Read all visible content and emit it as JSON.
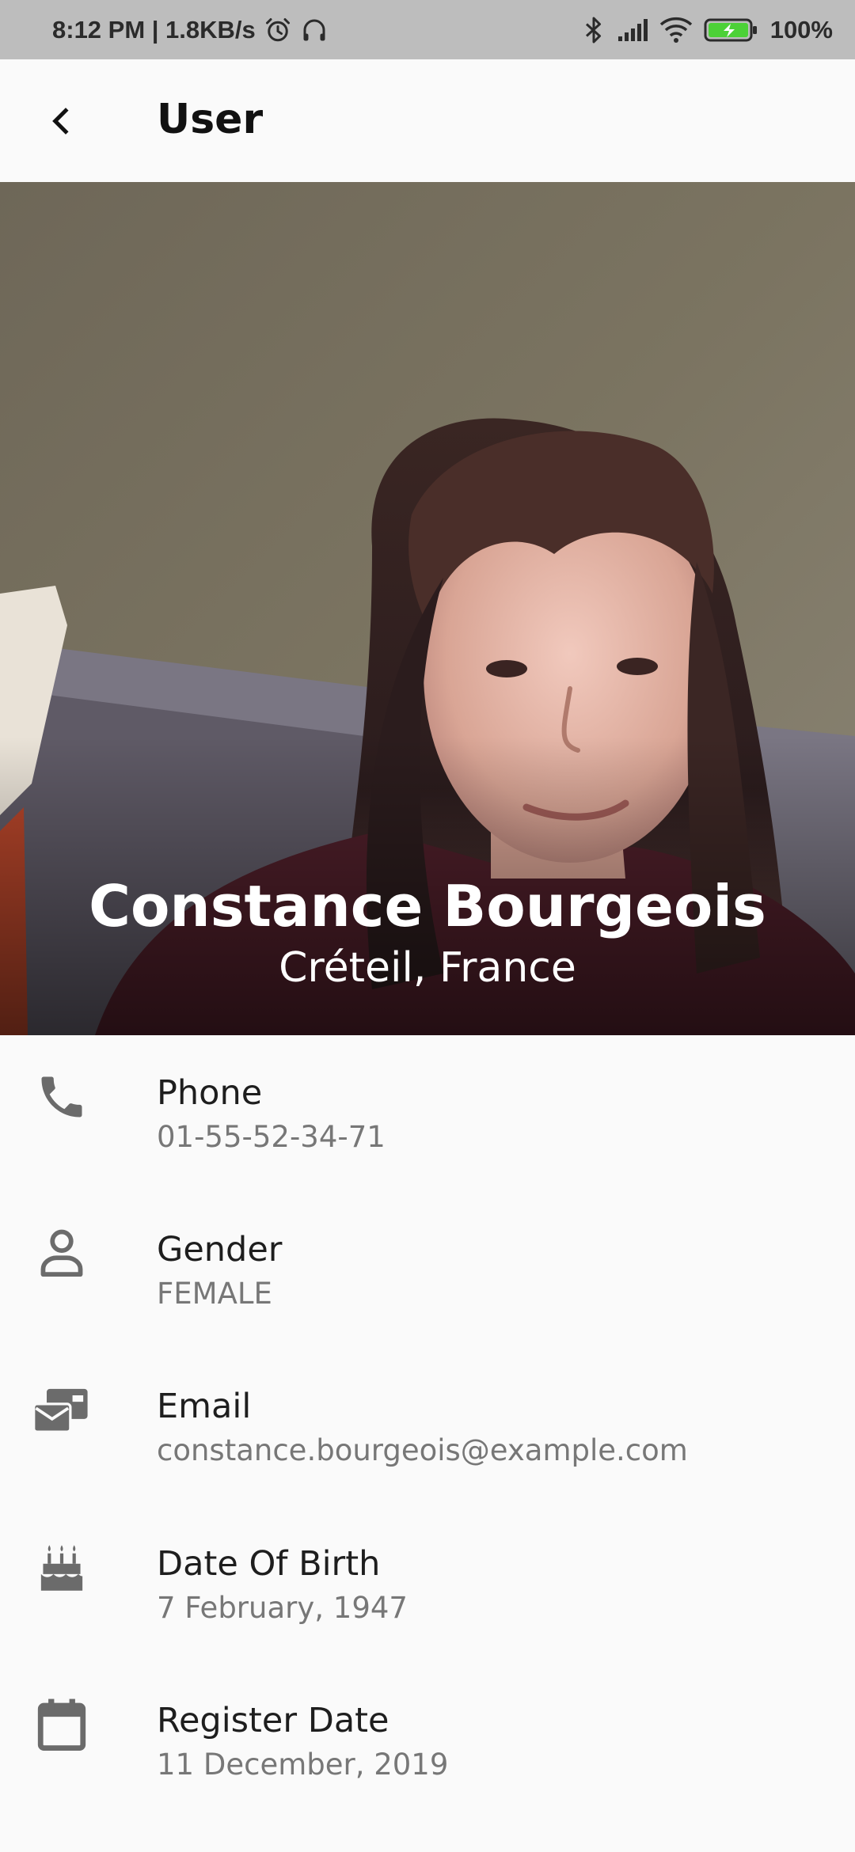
{
  "status_bar": {
    "time_speed": "8:12 PM | 1.8KB/s",
    "battery": "100%",
    "icons": [
      "alarm-icon",
      "headphones-icon",
      "bluetooth-icon",
      "signal-icon",
      "wifi-icon",
      "battery-charging-icon"
    ]
  },
  "app_bar": {
    "title": "User",
    "back_icon": "chevron-left-icon"
  },
  "profile": {
    "name": "Constance Bourgeois",
    "location": "Créteil, France"
  },
  "details": [
    {
      "icon": "phone-icon",
      "label": "Phone",
      "value": "01-55-52-34-71"
    },
    {
      "icon": "user-outline-icon",
      "label": "Gender",
      "value": "FEMALE"
    },
    {
      "icon": "mail-stack-icon",
      "label": "Email",
      "value": "constance.bourgeois@example.com"
    },
    {
      "icon": "birthday-cake-icon",
      "label": "Date Of Birth",
      "value": "7 February, 1947"
    },
    {
      "icon": "calendar-icon",
      "label": "Register Date",
      "value": "11 December, 2019"
    }
  ],
  "colors": {
    "status_bar_bg": "#bdbdbd",
    "app_bg": "#fafafa",
    "icon_gray": "#6b6b6b",
    "battery_green": "#4cd137"
  }
}
